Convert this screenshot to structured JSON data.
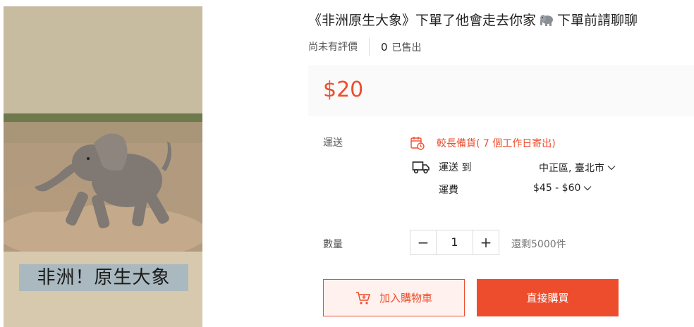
{
  "product": {
    "image_caption": "非洲！原生大象",
    "title_main": "《非洲原生大象》下單了他會走去你家",
    "title_icon": "elephant-icon",
    "title_tail": "下單前請聊聊"
  },
  "meta": {
    "rating_text": "尚未有評價",
    "sold_count": "0",
    "sold_label": "已售出"
  },
  "price": "$20",
  "shipping": {
    "label": "運送",
    "notice": "較長備貨( 7 個工作日寄出)",
    "ship_to_label": "運送 到",
    "location": "中正區, 臺北市",
    "fee_label": "運費",
    "fee_range": "$45 - $60"
  },
  "quantity": {
    "label": "數量",
    "value": "1",
    "minus": "−",
    "plus": "+",
    "stock": "還剩5000件"
  },
  "actions": {
    "add_to_cart": "加入購物車",
    "buy_now": "直接購買"
  },
  "colors": {
    "accent": "#ee4d2d",
    "price_bg": "#fafafa",
    "cart_bg": "#fff1ee"
  }
}
